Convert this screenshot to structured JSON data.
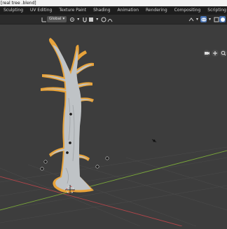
{
  "window": {
    "title": "[real tree .blend]"
  },
  "tabs": [
    {
      "label": "Sculpting"
    },
    {
      "label": "UV Editing"
    },
    {
      "label": "Texture Paint"
    },
    {
      "label": "Shading"
    },
    {
      "label": "Animation"
    },
    {
      "label": "Rendering"
    },
    {
      "label": "Compositing"
    },
    {
      "label": "Scripting"
    }
  ],
  "tab_add_label": "+",
  "toolbar": {
    "transform_orientation": "Global",
    "pivot_icon": "pivot-icon",
    "snap_icon": "magnet-icon",
    "proportional_icon": "proportional-edit-icon"
  },
  "header_right": {
    "icons": [
      "viewport-gizmo-icon",
      "overlay-icon",
      "xray-icon",
      "shading-solid-icon"
    ]
  },
  "colors": {
    "selection_outline": "#e8a33a",
    "x_axis": "#b3454a",
    "y_axis": "#7aa83a",
    "grid": "#4a4a4a",
    "active_button": "#4772b3"
  }
}
